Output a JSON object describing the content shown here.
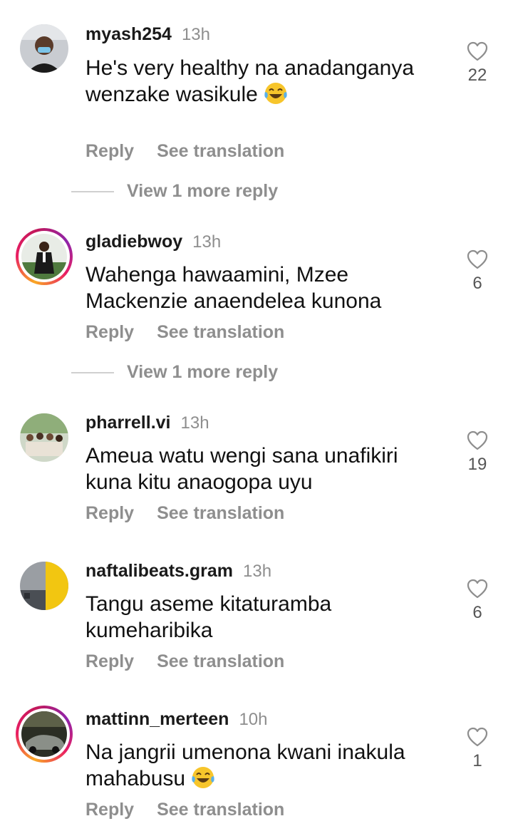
{
  "comments": [
    {
      "username": "myash254",
      "time": "13h",
      "text": "He's very healthy na anadanganya wenzake wasikule",
      "emoji": "😂",
      "reply_label": "Reply",
      "translate_label": "See translation",
      "likes": "22",
      "view_more": "View 1 more reply"
    },
    {
      "username": "gladiebwoy",
      "time": "13h",
      "text": "Wahenga hawaamini, Mzee Mackenzie anaendelea kunona",
      "reply_label": "Reply",
      "translate_label": "See translation",
      "likes": "6",
      "view_more": "View 1 more reply"
    },
    {
      "username": "pharrell.vi",
      "time": "13h",
      "text": "Ameua watu wengi sana unafikiri kuna kitu anaogopa uyu",
      "reply_label": "Reply",
      "translate_label": "See translation",
      "likes": "19"
    },
    {
      "username": "naftalibeats.gram",
      "time": "13h",
      "text": "Tangu aseme kitaturamba kumeharibika",
      "reply_label": "Reply",
      "translate_label": "See translation",
      "likes": "6"
    },
    {
      "username": "mattinn_merteen",
      "time": "10h",
      "text": "Na jangrii umenona kwani inakula mahabusu",
      "emoji": "😂",
      "reply_label": "Reply",
      "translate_label": "See translation",
      "likes": "1"
    }
  ],
  "colors": {
    "secondary_text": "#8e8e8e",
    "story_ring": "#e91e63"
  },
  "icons": {
    "like": "heart-outline-icon"
  }
}
